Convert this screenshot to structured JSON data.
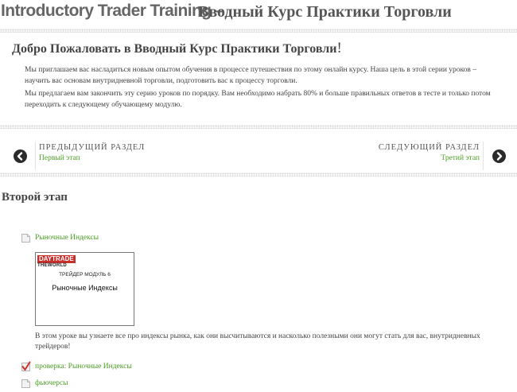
{
  "header": {
    "title_en": "Introductory Trader Training",
    "separator": "–",
    "title_ru": "Вводный Курс Практики Торговли"
  },
  "welcome": {
    "title": "Добро Пожаловать в Вводный Курс Практики Торговли",
    "exclamation": "!",
    "paragraph1": "Мы приглашаем вас насладиться новым опытом обучения в процессе путешествия по этому онлайн курсу. Наша цель в этой серии уроков – научить вас основам внутридневной торговли, подготовить вас к процессу торговли.",
    "paragraph2": "Мы предлагаем вам закончить эту серию уроков по порядку. Вам необходимо набрать 80% и больше правильных ответов в тесте и только потом переходить к следующему обучающему модулю."
  },
  "nav": {
    "prev_heading": "ПРЕДЫДУЩИЙ РАЗДЕЛ",
    "prev_link": "Первый этап",
    "next_heading": "СЛЕДУЮЩИЙ РАЗДЕЛ",
    "next_link": "Третий этап"
  },
  "section": {
    "title": "Второй этап"
  },
  "items": [
    {
      "label": "Рыночные Индексы",
      "icon": "page-icon"
    },
    {
      "label": "проверка: Рыночные Индексы",
      "icon": "quiz-check-icon"
    },
    {
      "label": "фьючерсы",
      "icon": "page-icon"
    }
  ],
  "lesson": {
    "thumb_brand_top": "DAYTRADE",
    "thumb_brand_bottom": "THEWORLD",
    "thumb_module": "ТРЕЙДЕР МОДУЛЬ 6",
    "thumb_title": "Рыночные Индексы",
    "description": "В этом уроке вы узнаете все про индексы рынка, как они высчитываются и насколько полезными они могут стать для вас, внутридневных трейдеров!"
  },
  "colors": {
    "link": "#4a9e23",
    "brand_red": "#c9302c",
    "arrow": "#2b2b2b"
  }
}
